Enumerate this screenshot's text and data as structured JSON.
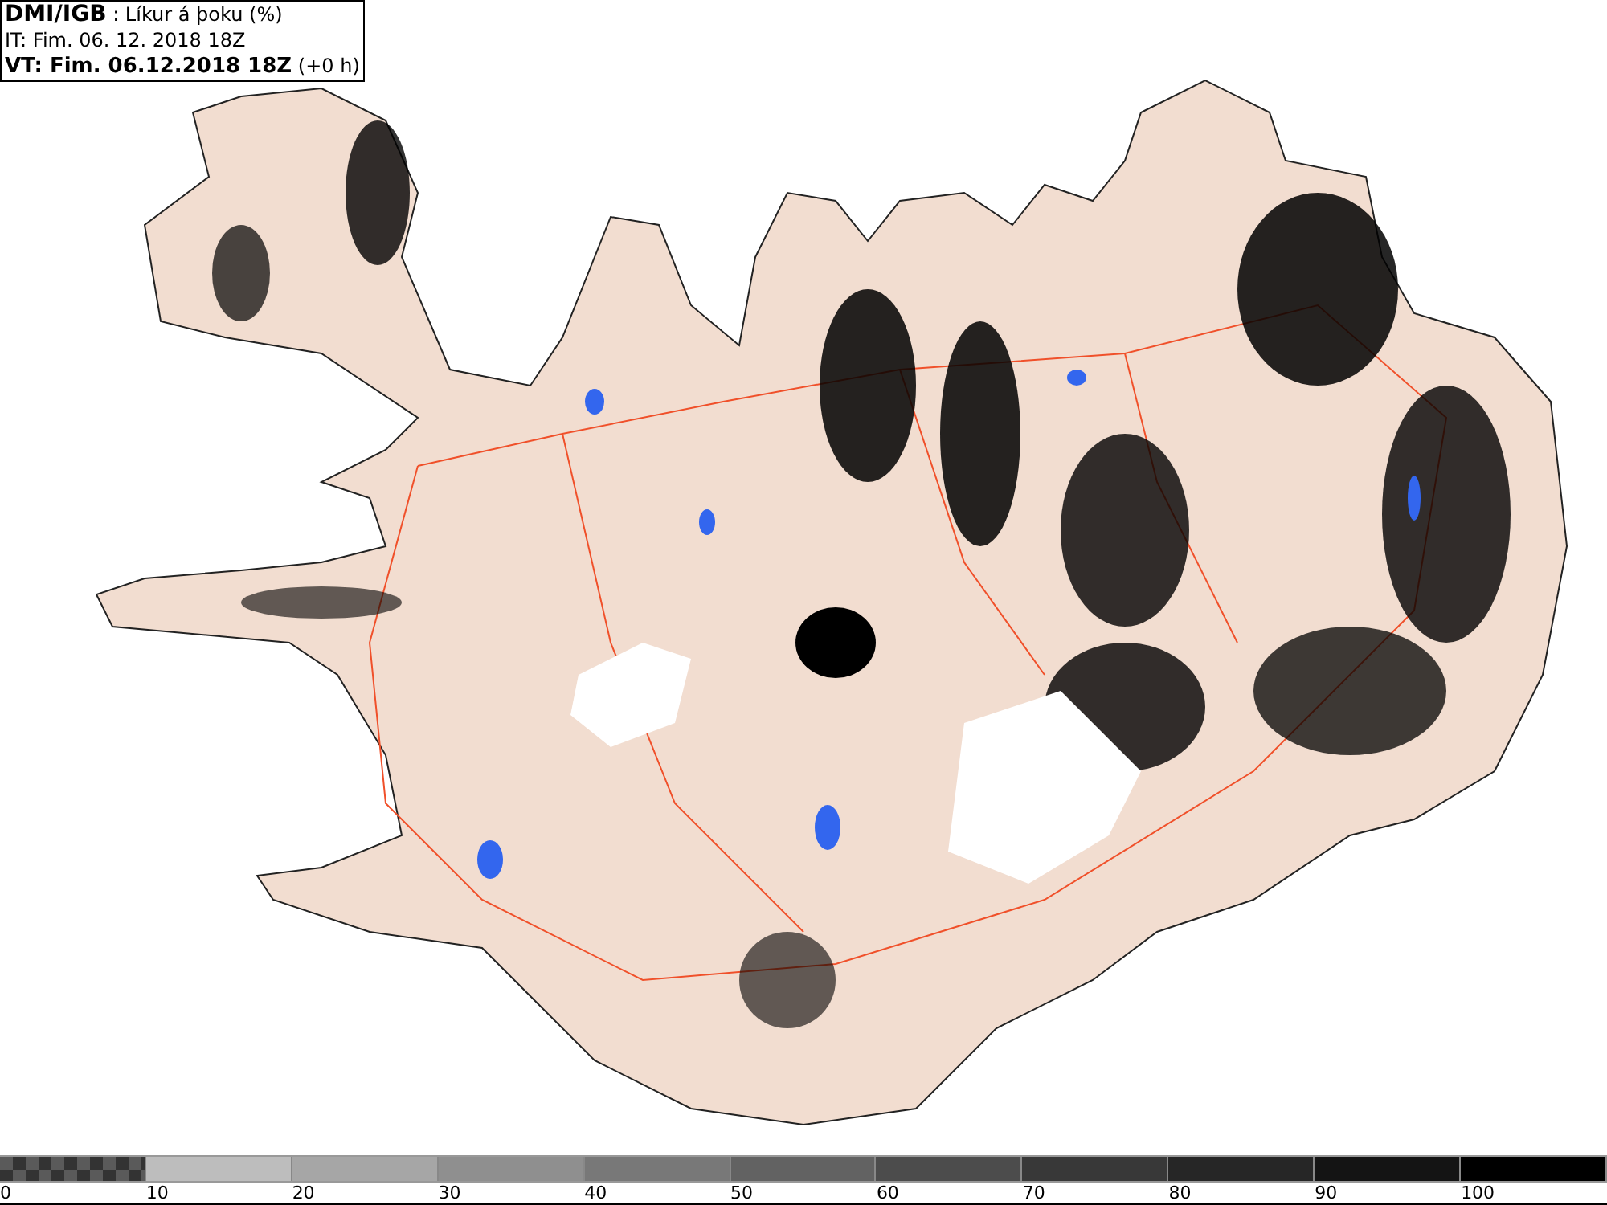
{
  "header": {
    "source": "DMI/IGB",
    "parameter": ": Líkur á þoku (%)",
    "init_time": "IT: Fim. 06. 12. 2018 18Z",
    "valid_time": "VT: Fim. 06.12.2018 18Z",
    "valid_offset": "(+0 h)"
  },
  "legend": {
    "bins": [
      {
        "kind": "checker",
        "color": "#5a5a5a"
      },
      {
        "kind": "solid",
        "color": "#bdbdbd"
      },
      {
        "kind": "solid",
        "color": "#a6a6a6"
      },
      {
        "kind": "solid",
        "color": "#8f8f8f"
      },
      {
        "kind": "solid",
        "color": "#787878"
      },
      {
        "kind": "solid",
        "color": "#626262"
      },
      {
        "kind": "solid",
        "color": "#4c4c4c"
      },
      {
        "kind": "solid",
        "color": "#383838"
      },
      {
        "kind": "solid",
        "color": "#262626"
      },
      {
        "kind": "solid",
        "color": "#141414"
      },
      {
        "kind": "solid",
        "color": "#000000"
      }
    ],
    "labels": [
      "0",
      "10",
      "20",
      "30",
      "40",
      "50",
      "60",
      "70",
      "80",
      "90",
      "100"
    ]
  }
}
